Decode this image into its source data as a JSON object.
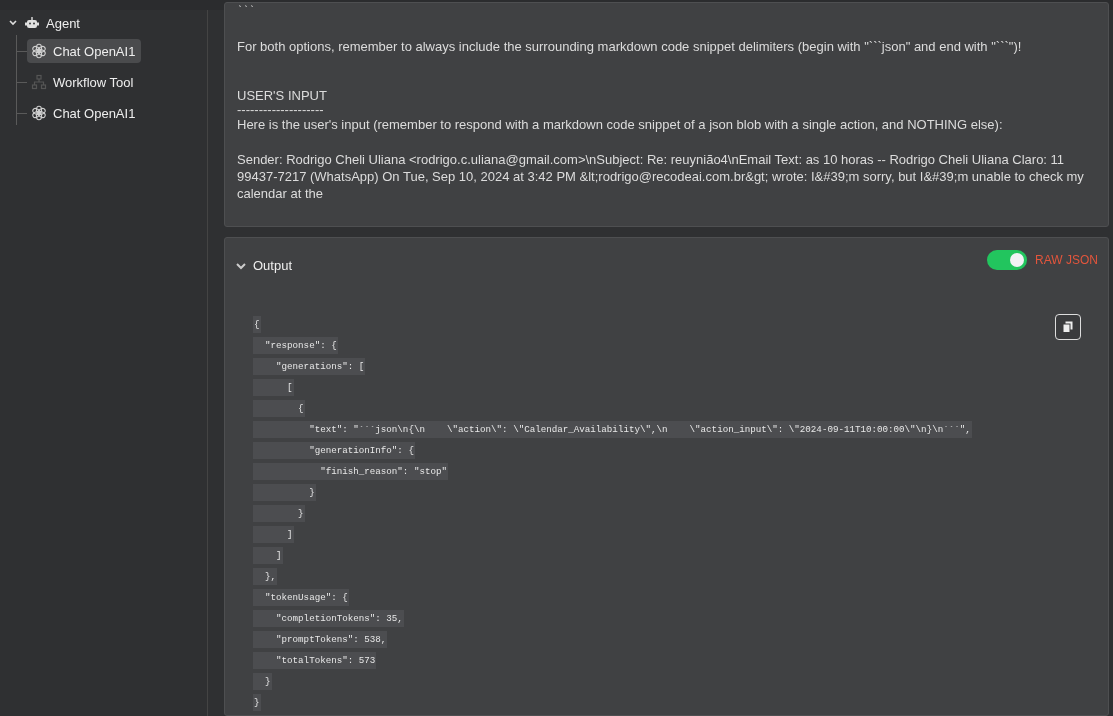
{
  "sidebar": {
    "tree": [
      {
        "label": "Agent",
        "kind": "robot",
        "expanded": true,
        "selected": false,
        "children": [
          {
            "label": "Chat OpenAI1",
            "kind": "openai",
            "selected": true
          },
          {
            "label": "Workflow Tool",
            "kind": "network",
            "selected": false
          },
          {
            "label": "Chat OpenAI1",
            "kind": "openai",
            "selected": false
          }
        ]
      }
    ]
  },
  "input_panel": {
    "paragraphs": [
      {
        "kind": "code",
        "text": "```"
      },
      {
        "kind": "text",
        "text": "For both options, remember to always include the surrounding markdown code snippet delimiters (begin with \"```json\" and end with \"```\")!"
      },
      {
        "kind": "heading",
        "text": "USER'S INPUT"
      },
      {
        "kind": "rule",
        "text": "--------------------"
      },
      {
        "kind": "text",
        "text": "Here is the user's input (remember to respond with a markdown code snippet of a json blob with a single action, and NOTHING else):"
      },
      {
        "kind": "text",
        "text": "Sender: Rodrigo Cheli Uliana <rodrigo.c.uliana@gmail.com>\\nSubject: Re: reuynião4\\nEmail Text: as 10 horas -- Rodrigo Cheli Uliana Claro: 11 99437-7217 (WhatsApp) On Tue, Sep 10, 2024 at 3:42 PM &lt;rodrigo@recodeai.com.br&gt; wrote: I&#39;m sorry, but I&#39;m unable to check my calendar at the"
      }
    ]
  },
  "output_panel": {
    "title": "Output",
    "expanded": true,
    "raw_json": {
      "label": "RAW JSON",
      "on": true
    },
    "lines": [
      "{",
      "  \"response\": {",
      "    \"generations\": [",
      "      [",
      "        {",
      "          \"text\": \"```json\\n{\\n    \\\"action\\\": \\\"Calendar_Availability\\\",\\n    \\\"action_input\\\": \\\"2024-09-11T10:00:00\\\"\\n}\\n```\",",
      "          \"generationInfo\": {",
      "            \"finish_reason\": \"stop\"",
      "          }",
      "        }",
      "      ]",
      "    ]",
      "  },",
      "  \"tokenUsage\": {",
      "    \"completionTokens\": 35,",
      "    \"promptTokens\": 538,",
      "    \"totalTokens\": 573",
      "  }",
      "}"
    ]
  }
}
